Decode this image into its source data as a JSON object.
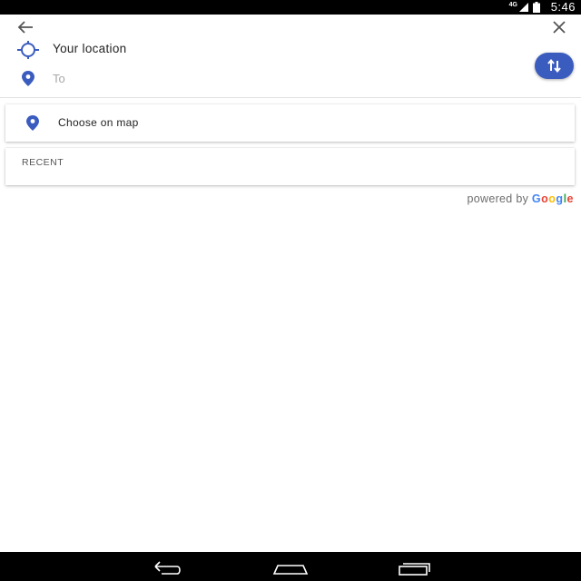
{
  "status_bar": {
    "time": "5:46",
    "network": "4G"
  },
  "directions": {
    "from": "Your location",
    "to_placeholder": "To",
    "to_value": ""
  },
  "choose_on_map": "Choose on map",
  "recent": {
    "header": "RECENT"
  },
  "attribution": {
    "prefix": "powered by",
    "brand_letters": [
      "G",
      "o",
      "o",
      "g",
      "l",
      "e"
    ]
  },
  "colors": {
    "accent": "#3b5cbf",
    "status_bar": "#000000",
    "nav_bar": "#000000"
  },
  "icons": {
    "back": "arrow-left-icon",
    "close": "close-icon",
    "location": "my-location-icon",
    "pin": "place-pin-icon",
    "swap": "swap-vertical-icon",
    "nav_back": "nav-back-icon",
    "nav_home": "nav-home-icon",
    "nav_recents": "nav-recents-icon"
  }
}
